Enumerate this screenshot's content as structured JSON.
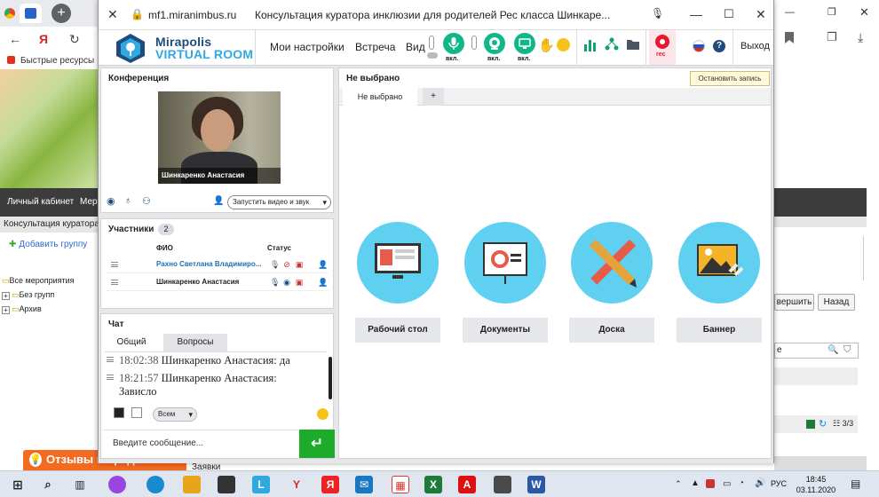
{
  "popup": {
    "url": "mf1.miranimbus.ru",
    "title": "Консультация куратора инклюзии для родителей Рес класса Шинкаре..."
  },
  "app": {
    "logo_top": "Mirapolis",
    "logo_bottom": "VIRTUAL ROOM",
    "menu": [
      "Мои настройки",
      "Встреча",
      "Вид"
    ],
    "mic_label": "вкл.",
    "cam_label": "вкл.",
    "screen_label": "вкл.",
    "rec_label": "rec",
    "exit_label": "Выход",
    "rec_tooltip": "Остановить запись"
  },
  "conference": {
    "title": "Конференция",
    "video_caption": "Шинкаренко Анастасия",
    "start_select": "Запустить видео и звук"
  },
  "participants": {
    "title": "Участники",
    "count": "2",
    "col_name": "ФИО",
    "col_status": "Статус",
    "rows": [
      {
        "name": "Рахно Светлана Владимиро..."
      },
      {
        "name": "Шинкаренко Анастасия"
      }
    ]
  },
  "chat": {
    "title": "Чат",
    "tab_all": "Общий",
    "tab_questions": "Вопросы",
    "messages": [
      {
        "time": "18:02:38",
        "text": "Шинкаренко Анастасия: да"
      },
      {
        "time": "18:21:57",
        "text": "Шинкаренко Анастасия:",
        "text2": "Зависло"
      }
    ],
    "recipients": "Всем",
    "placeholder": "Введите сообщение..."
  },
  "workspace": {
    "title": "Не выбрано",
    "tab": "Не выбрано",
    "add_tab": "+",
    "cards": [
      "Рабочий стол",
      "Документы",
      "Доска",
      "Баннер"
    ]
  },
  "background": {
    "bookmark": "Быстрые ресурсы",
    "menu_left": "Личный кабинет",
    "menu_next": "Мер",
    "crumb": "Консультация куратора",
    "add_group": "Добавить группу",
    "tree": [
      "Все мероприятия",
      "Без групп",
      "Архив"
    ],
    "btn_finish": "вершить",
    "btn_back": "Назад",
    "search_val": "е",
    "pager": "3/3",
    "feedback": "Отзывы и предложения",
    "applications": "Заявки"
  },
  "taskbar": {
    "lang": "РУС",
    "time": "18:45",
    "date": "03.11.2020"
  },
  "colors": {
    "accent_green": "#10b889",
    "record_red": "#e8182c",
    "tile_blue": "#5fd0f0",
    "send_green": "#1eab2b",
    "feedback_orange": "#f26b21"
  }
}
